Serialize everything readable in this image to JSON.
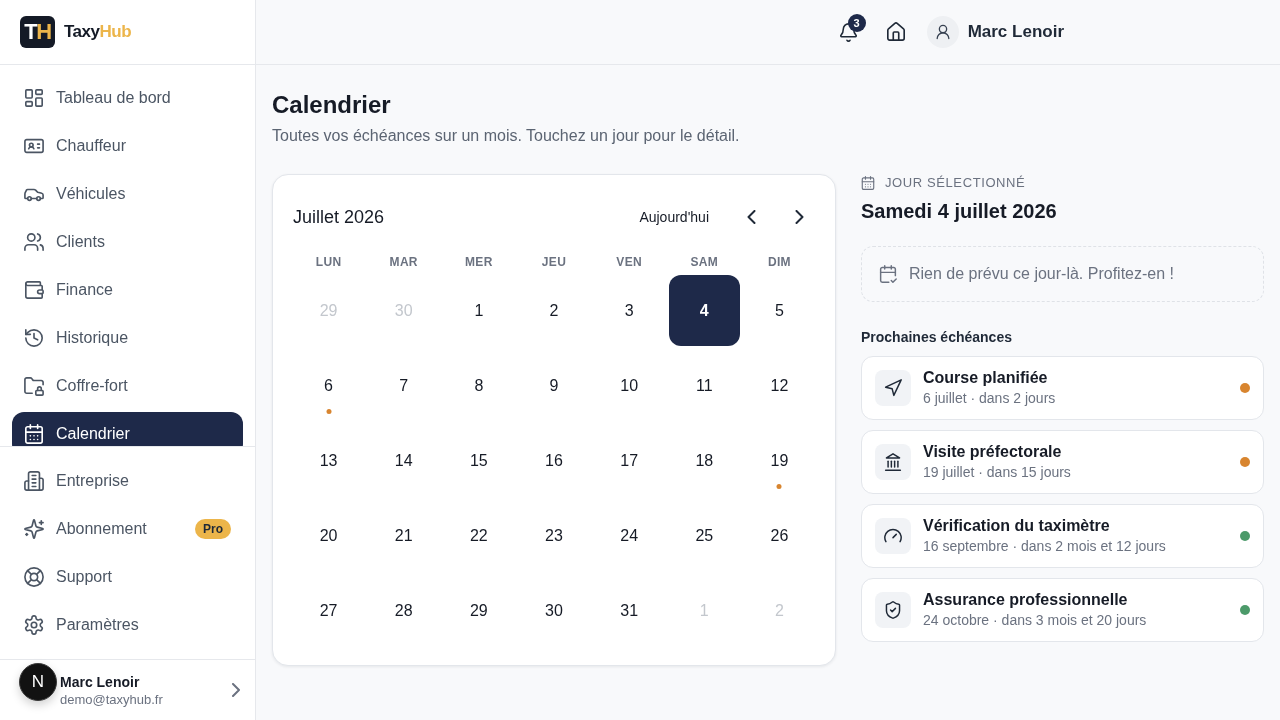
{
  "sidebar": {
    "brand": {
      "mark": [
        "T",
        "H"
      ],
      "name": [
        "Taxy",
        "Hub"
      ]
    },
    "nav": [
      {
        "label": "Tableau de bord",
        "selected": false
      },
      {
        "label": "Chauffeur",
        "selected": false
      },
      {
        "label": "Véhicules",
        "selected": false
      },
      {
        "label": "Clients",
        "selected": false
      },
      {
        "label": "Finance",
        "selected": false
      },
      {
        "label": "Historique",
        "selected": false
      },
      {
        "label": "Coffre-fort",
        "selected": false
      },
      {
        "label": "Calendrier",
        "selected": true
      }
    ],
    "nav_secondary": [
      {
        "label": "Entreprise",
        "selected": false
      },
      {
        "label": "Abonnement",
        "selected": false,
        "badge": "Pro"
      },
      {
        "label": "Support",
        "selected": false
      },
      {
        "label": "Paramètres",
        "selected": false
      }
    ],
    "user": {
      "name": "Marc Lenoir",
      "email": "demo@taxyhub.fr"
    }
  },
  "dev_badge": "N",
  "header": {
    "notifications": "3",
    "user_name": "Marc Lenoir"
  },
  "page": {
    "title": "Calendrier",
    "subtitle": "Toutes vos échéances sur un mois. Touchez un jour pour le détail."
  },
  "calendar": {
    "month": "Juillet 2026",
    "today_button": "Aujourd'hui",
    "weekdays": [
      "LUN",
      "MAR",
      "MER",
      "JEU",
      "VEN",
      "SAM",
      "DIM"
    ],
    "days": [
      {
        "label": "29",
        "outside": true,
        "selected": false
      },
      {
        "label": "30",
        "outside": true,
        "selected": false
      },
      {
        "label": "1",
        "outside": false,
        "selected": false
      },
      {
        "label": "2",
        "outside": false,
        "selected": false
      },
      {
        "label": "3",
        "outside": false,
        "selected": false
      },
      {
        "label": "4",
        "outside": false,
        "selected": true
      },
      {
        "label": "5",
        "outside": false,
        "selected": false
      },
      {
        "label": "6",
        "outside": false,
        "selected": false,
        "color": "#d8852f"
      },
      {
        "label": "7",
        "outside": false,
        "selected": false
      },
      {
        "label": "8",
        "outside": false,
        "selected": false
      },
      {
        "label": "9",
        "outside": false,
        "selected": false
      },
      {
        "label": "10",
        "outside": false,
        "selected": false
      },
      {
        "label": "11",
        "outside": false,
        "selected": false
      },
      {
        "label": "12",
        "outside": false,
        "selected": false
      },
      {
        "label": "13",
        "outside": false,
        "selected": false
      },
      {
        "label": "14",
        "outside": false,
        "selected": false
      },
      {
        "label": "15",
        "outside": false,
        "selected": false
      },
      {
        "label": "16",
        "outside": false,
        "selected": false
      },
      {
        "label": "17",
        "outside": false,
        "selected": false
      },
      {
        "label": "18",
        "outside": false,
        "selected": false
      },
      {
        "label": "19",
        "outside": false,
        "selected": false,
        "color": "#d8852f"
      },
      {
        "label": "20",
        "outside": false,
        "selected": false
      },
      {
        "label": "21",
        "outside": false,
        "selected": false
      },
      {
        "label": "22",
        "outside": false,
        "selected": false
      },
      {
        "label": "23",
        "outside": false,
        "selected": false
      },
      {
        "label": "24",
        "outside": false,
        "selected": false
      },
      {
        "label": "25",
        "outside": false,
        "selected": false
      },
      {
        "label": "26",
        "outside": false,
        "selected": false
      },
      {
        "label": "27",
        "outside": false,
        "selected": false
      },
      {
        "label": "28",
        "outside": false,
        "selected": false
      },
      {
        "label": "29",
        "outside": false,
        "selected": false
      },
      {
        "label": "30",
        "outside": false,
        "selected": false
      },
      {
        "label": "31",
        "outside": false,
        "selected": false
      },
      {
        "label": "1",
        "outside": true,
        "selected": false
      },
      {
        "label": "2",
        "outside": true,
        "selected": false
      }
    ]
  },
  "selected_day": {
    "label": "JOUR SÉLECTIONNÉ",
    "date": "Samedi 4 juillet 2026",
    "empty_message": "Rien de prévu ce jour-là. Profitez-en !"
  },
  "upcoming": {
    "title": "Prochaines échéances",
    "items": [
      {
        "title": "Course planifiée",
        "detail": "6 juillet · dans 2 jours",
        "color": "#d8852f"
      },
      {
        "title": "Visite préfectorale",
        "detail": "19 juillet · dans 15 jours",
        "color": "#d8852f"
      },
      {
        "title": "Vérification du taximètre",
        "detail": "16 septembre · dans 2 mois et 12 jours",
        "color": "#4c9a6a"
      },
      {
        "title": "Assurance professionnelle",
        "detail": "24 octobre · dans 3 mois et 20 jours",
        "color": "#4c9a6a"
      }
    ]
  }
}
